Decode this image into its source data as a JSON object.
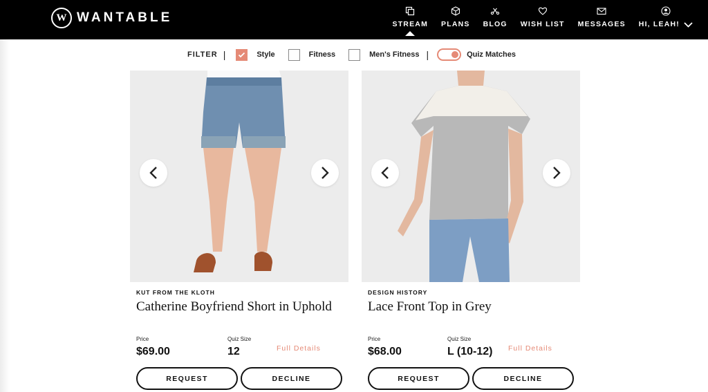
{
  "brand": {
    "name": "WANTABLE",
    "badge": "W"
  },
  "nav": {
    "items": [
      {
        "label": "STREAM",
        "icon": "stream-icon",
        "active": true
      },
      {
        "label": "PLANS",
        "icon": "box-icon"
      },
      {
        "label": "BLOG",
        "icon": "blog-icon"
      },
      {
        "label": "WISH LIST",
        "icon": "heart-icon"
      },
      {
        "label": "MESSAGES",
        "icon": "envelope-icon"
      }
    ],
    "user": {
      "label": "HI, LEAH!",
      "icon": "user-icon"
    }
  },
  "filter": {
    "label": "FILTER",
    "options": [
      {
        "label": "Style",
        "checked": true
      },
      {
        "label": "Fitness",
        "checked": false
      },
      {
        "label": "Men's Fitness",
        "checked": false
      }
    ],
    "toggle": {
      "label": "Quiz Matches",
      "on": true
    }
  },
  "colors": {
    "accent": "#e58a76",
    "nav_bg": "#000000",
    "photo_bg": "#ececec"
  },
  "products": [
    {
      "brand": "KUT FROM THE KLOTH",
      "title": "Catherine Boyfriend Short in Uphold",
      "price_label": "Price",
      "price": "$69.00",
      "size_label": "Quiz Size",
      "size": "12",
      "details_label": "Full Details",
      "request_label": "REQUEST",
      "decline_label": "DECLINE"
    },
    {
      "brand": "DESIGN HISTORY",
      "title": "Lace Front Top in Grey",
      "price_label": "Price",
      "price": "$68.00",
      "size_label": "Quiz Size",
      "size": "L (10-12)",
      "details_label": "Full Details",
      "request_label": "REQUEST",
      "decline_label": "DECLINE"
    }
  ]
}
